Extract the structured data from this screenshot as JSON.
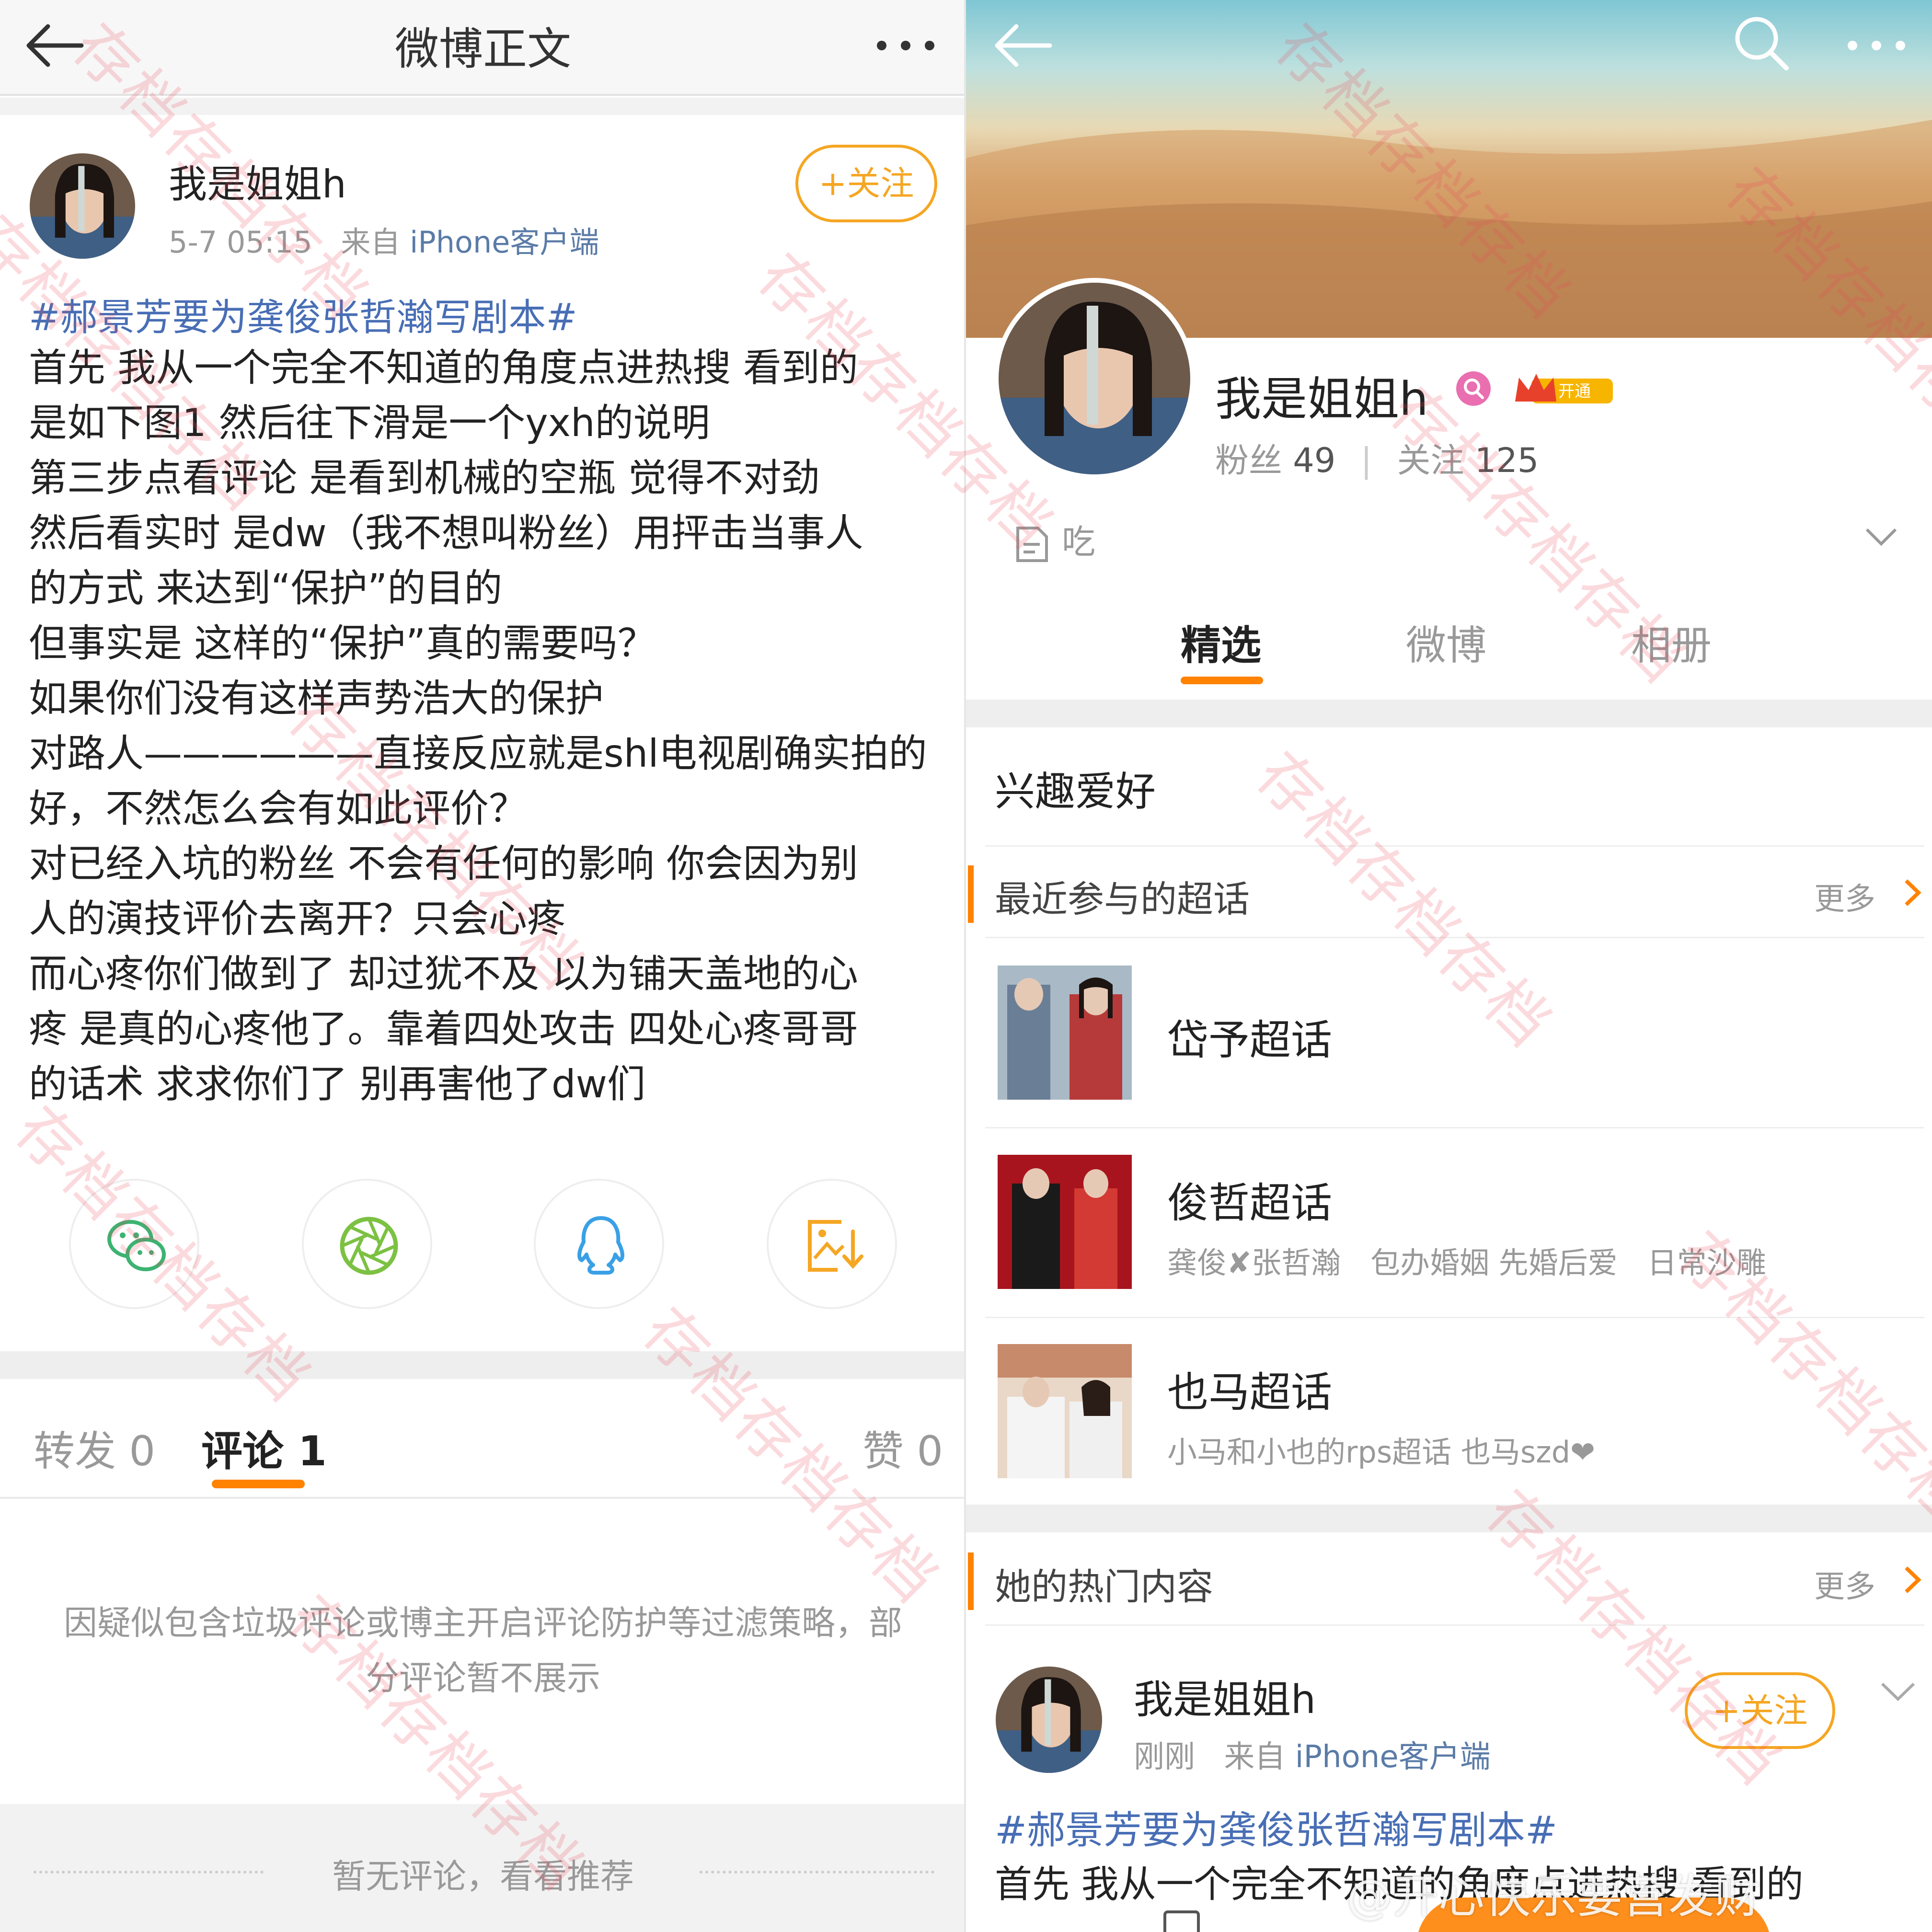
{
  "left": {
    "nav_title": "微博正文",
    "author": {
      "name": "我是姐姐h",
      "time": "5-7 05:15",
      "source_prefix": "来自",
      "source": "iPhone客户端"
    },
    "follow_label": "+关注",
    "hashtag": "#郝景芳要为龚俊张哲瀚写剧本#",
    "body_lines": [
      "首先 我从一个完全不知道的角度点进热搜 看到的",
      "是如下图1 然后往下滑是一个yxh的说明",
      "第三步点看评论 是看到机械的空瓶 觉得不对劲",
      "然后看实时 是dw（我不想叫粉丝）用抨击当事人",
      "的方式 来达到“保护”的目的",
      "但事实是 这样的“保护”真的需要吗？",
      "如果你们没有这样声势浩大的保护",
      "对路人——————直接反应就是shl电视剧确实拍的",
      "好，不然怎么会有如此评价？",
      "对已经入坑的粉丝 不会有任何的影响 你会因为别",
      "人的演技评价去离开？只会心疼",
      "而心疼你们做到了 却过犹不及 以为铺天盖地的心",
      "疼 是真的心疼他了。靠着四处攻击 四处心疼哥哥",
      "的话术 求求你们了 别再害他了dw们"
    ],
    "share_icons": [
      "wechat-icon",
      "moments-icon",
      "qq-icon",
      "save-image-icon"
    ],
    "tabs": [
      {
        "label": "转发 0"
      },
      {
        "label": "评论 1"
      },
      {
        "label": "赞 0"
      }
    ],
    "active_tab": "评论 1",
    "filter_notice_line1": "因疑似包含垃圾评论或博主开启评论防护等过滤策略，部",
    "filter_notice_line2": "分评论暂不展示",
    "no_comments": "暂无评论，看看推荐"
  },
  "right": {
    "profile": {
      "name": "我是姐姐h",
      "badge_label": "开通",
      "fans_label": "粉丝",
      "fans_count": "49",
      "separator": "|",
      "following_label": "关注",
      "following_count": "125",
      "bio": "吃"
    },
    "tabs": [
      {
        "label": "精选"
      },
      {
        "label": "微博"
      },
      {
        "label": "相册"
      }
    ],
    "active_tab": "精选",
    "hobby_title": "兴趣爱好",
    "supertopics": {
      "title": "最近参与的超话",
      "more": "更多",
      "items": [
        {
          "name": "岱予超话",
          "desc": ""
        },
        {
          "name": "俊哲超话",
          "desc": "龚俊✘张哲瀚　包办婚姻 先婚后爱　日常沙雕"
        },
        {
          "name": "也马超话",
          "desc": "小马和小也的rps超话 也马szd❤"
        }
      ]
    },
    "hot": {
      "title": "她的热门内容",
      "more": "更多"
    },
    "post": {
      "name": "我是姐姐h",
      "time": "刚刚",
      "source_prefix": "来自",
      "source": "iPhone客户端",
      "follow_label": "+关注",
      "hashtag": "#郝景芳要为龚俊张哲瀚写剧本#",
      "body_start": "首先 我从一个完全不知道的角度点进热搜 看到的"
    }
  },
  "watermark_text": "存档存档存档",
  "credit": "@开心快乐要营发财",
  "colors": {
    "accent": "#ff8200",
    "follow": "#f5a623",
    "link": "#486eb5",
    "watermark": "#ec465a"
  }
}
